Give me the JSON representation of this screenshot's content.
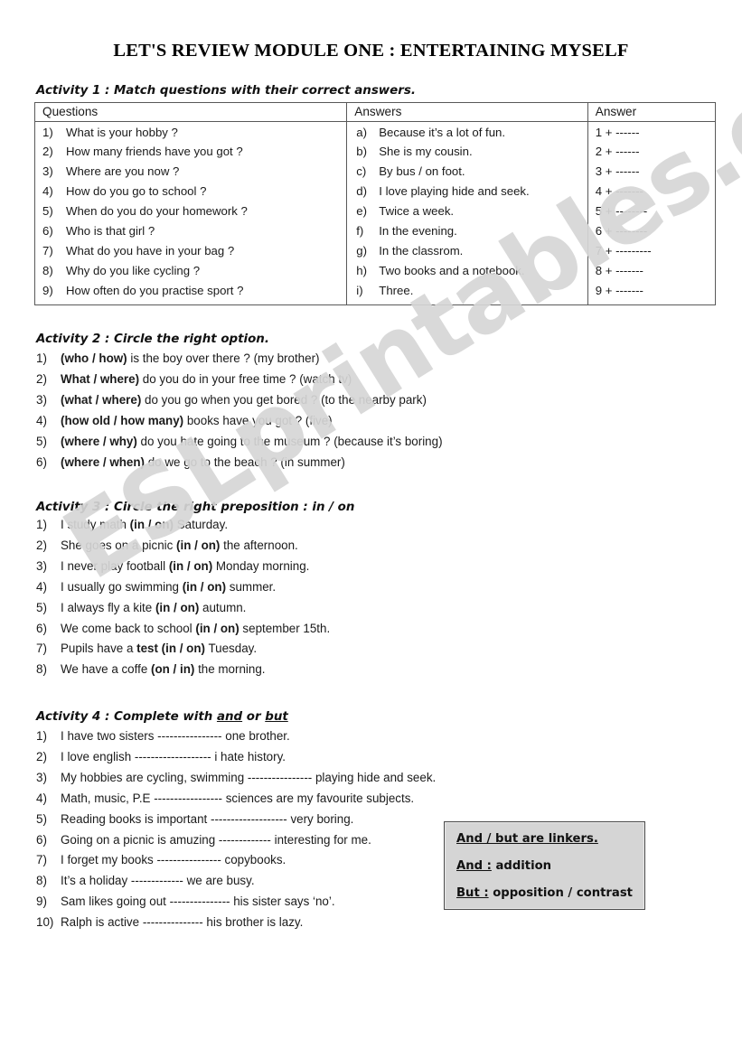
{
  "document": {
    "title": "LET'S REVIEW MODULE ONE : ENTERTAINING MYSELF",
    "watermark": "ESLprintables.com",
    "watermark_color": "#d6d6d6"
  },
  "activity1": {
    "heading": "Activity 1 : Match questions with their correct answers.",
    "columns": {
      "questions": "Questions",
      "answers": "Answers",
      "answer": "Answer"
    },
    "questions": [
      {
        "num": "1)",
        "text": "What is your hobby ?"
      },
      {
        "num": "2)",
        "text": "How many friends have you got ?"
      },
      {
        "num": "3)",
        "text": "Where are you now ?"
      },
      {
        "num": "4)",
        "text": "How do you go to school ?"
      },
      {
        "num": "5)",
        "text": "When do you do your homework ?"
      },
      {
        "num": "6)",
        "text": "Who is that girl ?"
      },
      {
        "num": "7)",
        "text": "What do you have in your bag ?"
      },
      {
        "num": "8)",
        "text": "Why do you like cycling ?"
      },
      {
        "num": "9)",
        "text": "How often do you practise sport ?"
      }
    ],
    "answers": [
      {
        "num": "a)",
        "text": "Because it’s a lot of fun."
      },
      {
        "num": "b)",
        "text": "She is my cousin."
      },
      {
        "num": "c)",
        "text": "By bus / on foot."
      },
      {
        "num": "d)",
        "text": "I love playing hide and seek."
      },
      {
        "num": "e)",
        "text": "Twice a week."
      },
      {
        "num": "f)",
        "text": "In the evening."
      },
      {
        "num": "g)",
        "text": "In the classrom."
      },
      {
        "num": "h)",
        "text": "Two books and a notebook."
      },
      {
        "num": "i)",
        "text": "Three."
      }
    ],
    "answer_slots": [
      "1 + ------",
      "2 + ------",
      "3 + ------",
      "4 + -------",
      "5 + --------",
      "6 + --------",
      "7 + ---------",
      "8 + -------",
      "9 + -------"
    ]
  },
  "activity2": {
    "heading": "Activity 2 : Circle the right option.",
    "items": [
      {
        "num": "1)",
        "option": "(who / how)",
        "rest": " is the boy over there ? (my brother)"
      },
      {
        "num": "2)",
        "option": "What / where)",
        "rest": " do you do in your free time ? (watch tv)"
      },
      {
        "num": "3)",
        "option": "(what / where)",
        "rest": " do you go when you get bored ? (to the nearby park)"
      },
      {
        "num": "4)",
        "option": "(how old / how many)",
        "rest": " books have you got ? (five)"
      },
      {
        "num": "5)",
        "option": "(where / why)",
        "rest": " do you hate going to the museum ? (because it’s boring)"
      },
      {
        "num": "6)",
        "option": "(where / when)",
        "rest": " do we go to the beach ? (in summer)"
      }
    ]
  },
  "activity3": {
    "heading": "Activity 3 : Circle the right preposition : in / on",
    "items": [
      {
        "num": "1)",
        "pre": "I study math ",
        "option": "(in / on)",
        "post": " Saturday."
      },
      {
        "num": "2)",
        "pre": "She goes on a picnic ",
        "option": "(in / on)",
        "post": " the afternoon."
      },
      {
        "num": "3)",
        "pre": "I never play football ",
        "option": "(in / on)",
        "post": " Monday morning."
      },
      {
        "num": "4)",
        "pre": "I usually go swimming ",
        "option": "(in / on)",
        "post": " summer."
      },
      {
        "num": "5)",
        "pre": "I always fly a kite ",
        "option": "(in / on)",
        "post": " autumn."
      },
      {
        "num": "6)",
        "pre": "We come back to school ",
        "option": "(in / on)",
        "post": " september 15th."
      },
      {
        "num": "7)",
        "pre": "Pupils have a ",
        "option": "test (in / on)",
        "post": " Tuesday."
      },
      {
        "num": "8)",
        "pre": "We have a coffe ",
        "option": "(on / in)",
        "post": " the morning."
      }
    ]
  },
  "activity4": {
    "heading_prefix": "Activity 4 : Complete with ",
    "heading_and": "and",
    "heading_mid": " or ",
    "heading_but": "but",
    "items": [
      {
        "num": "1)",
        "pre": "I have two sisters ",
        "blank": "----------------",
        "post": " one brother."
      },
      {
        "num": "2)",
        "pre": "I love english ",
        "blank": "-------------------",
        "post": " i hate history."
      },
      {
        "num": "3)",
        "pre": "My hobbies are cycling, swimming ",
        "blank": "----------------",
        "post": " playing hide and seek."
      },
      {
        "num": "4)",
        "pre": "Math, music, P.E ",
        "blank": "-----------------",
        "post": " sciences are my favourite subjects."
      },
      {
        "num": "5)",
        "pre": "Reading books is important ",
        "blank": "-------------------",
        "post": " very boring."
      },
      {
        "num": "6)",
        "pre": "Going on a picnic is amuzing ",
        "blank": "-------------",
        "post": " interesting for me."
      },
      {
        "num": "7)",
        "pre": "I forget my books ",
        "blank": "----------------",
        "post": " copybooks."
      },
      {
        "num": "8)",
        "pre": "It’s a holiday ",
        "blank": "-------------",
        "post": " we are busy."
      },
      {
        "num": "9)",
        "pre": "Sam likes going out ",
        "blank": "---------------",
        "post": " his sister says ‘no’."
      },
      {
        "num": "10)",
        "pre": "Ralph is active ",
        "blank": "---------------",
        "post": " his brother is lazy."
      }
    ]
  },
  "note_box": {
    "line1_underlined": "And / but are linkers.",
    "line2_underlined": "And :",
    "line2_rest": " addition",
    "line3_underlined": "But :",
    "line3_rest": " opposition / contrast"
  }
}
